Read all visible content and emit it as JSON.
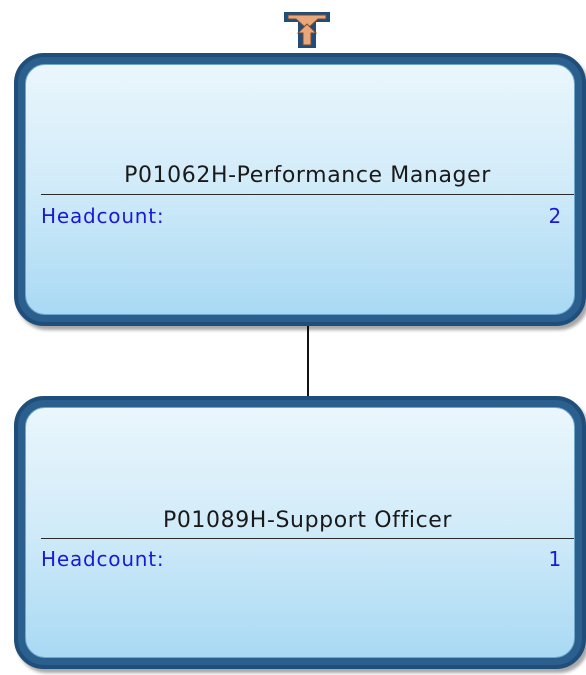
{
  "colors": {
    "node_border": "#1e4e79",
    "node_fill_top": "#eaf6fc",
    "node_fill_bottom": "#a9d9f4",
    "headcount_text": "#1a1ad6",
    "arrow_fill": "#e8a87c",
    "connector": "#111111"
  },
  "icons": {
    "navigate_up": "up-arrow-icon"
  },
  "nodes": [
    {
      "title": "P01062H-Performance Manager",
      "headcount_label": "Headcount:",
      "headcount_value": "2"
    },
    {
      "title": "P01089H-Support Officer",
      "headcount_label": "Headcount:",
      "headcount_value": "1"
    }
  ]
}
